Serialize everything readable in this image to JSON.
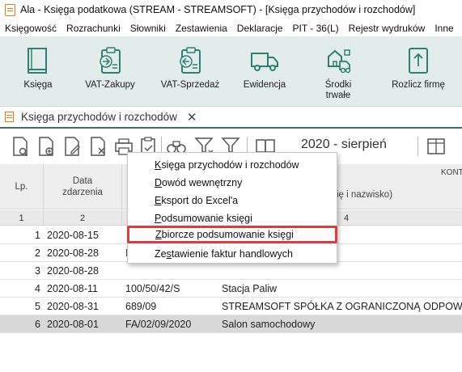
{
  "window": {
    "title": "Ala - Księga podatkowa (STREAM - STREAMSOFT) - [Księga przychodów i rozchodów]"
  },
  "menubar": {
    "items": [
      {
        "label": "Księgowość"
      },
      {
        "label": "Rozrachunki"
      },
      {
        "label": "Słowniki"
      },
      {
        "label": "Zestawienia"
      },
      {
        "label": "Deklaracje"
      },
      {
        "label": "PIT - 36(L)"
      },
      {
        "label": "Rejestr wydruków"
      },
      {
        "label": "Inne"
      }
    ]
  },
  "ribbon": {
    "buttons": [
      {
        "label": "Księga",
        "icon": "book-icon"
      },
      {
        "label": "VAT-Zakupy",
        "icon": "clipboard-in-icon"
      },
      {
        "label": "VAT-Sprzedaż",
        "icon": "clipboard-out-icon"
      },
      {
        "label": "Ewidencja",
        "icon": "truck-icon"
      },
      {
        "label": "Środki\ntrwałe",
        "icon": "fixed-assets-icon"
      },
      {
        "label": "Rozlicz firmę",
        "icon": "upload-doc-icon"
      }
    ],
    "accent": "#2f7f74",
    "background": "#e2ecea"
  },
  "doc_tab": {
    "label": "Księga przychodów i rozchodów",
    "close": "✕"
  },
  "toolbar": {
    "period": "2020 - sierpień"
  },
  "grid": {
    "headers": {
      "lp": "Lp.",
      "date": "Data zdarzenia",
      "contractor_group": "KONT",
      "name_partial": "ię i nazwisko)"
    },
    "column_numbers": [
      "1",
      "2",
      "4"
    ],
    "rows": [
      {
        "lp": "1",
        "date": "2020-08-15",
        "doc": "",
        "name": ""
      },
      {
        "lp": "2",
        "date": "2020-08-28",
        "doc": "I",
        "name": ""
      },
      {
        "lp": "3",
        "date": "2020-08-28",
        "doc": "",
        "name": ""
      },
      {
        "lp": "4",
        "date": "2020-08-11",
        "doc": "100/50/42/S",
        "name": "Stacja Paliw"
      },
      {
        "lp": "5",
        "date": "2020-08-31",
        "doc": "689/09",
        "name": "STREAMSOFT SPÓŁKA Z OGRANICZONĄ ODPOWIE"
      },
      {
        "lp": "6",
        "date": "2020-08-01",
        "doc": "FA/02/09/2020",
        "name": "Salon samochodowy"
      }
    ],
    "selected_row": 6
  },
  "dropdown": {
    "items": [
      {
        "pre": "",
        "ul": "K",
        "post": "sięga przychodów i rozchodów"
      },
      {
        "pre": "",
        "ul": "D",
        "post": "owód wewnętrzny"
      },
      {
        "pre": "",
        "ul": "E",
        "post": "ksport do Excel'a"
      },
      {
        "pre": "",
        "ul": "P",
        "post": "odsumowanie księgi"
      },
      {
        "pre": "",
        "ul": "Z",
        "post": "biorcze podsumowanie księgi"
      },
      {
        "pre": "Ze",
        "ul": "s",
        "post": "tawienie faktur handlowych"
      }
    ],
    "highlight_color": "#e0393f",
    "highlighted_index": 4
  }
}
